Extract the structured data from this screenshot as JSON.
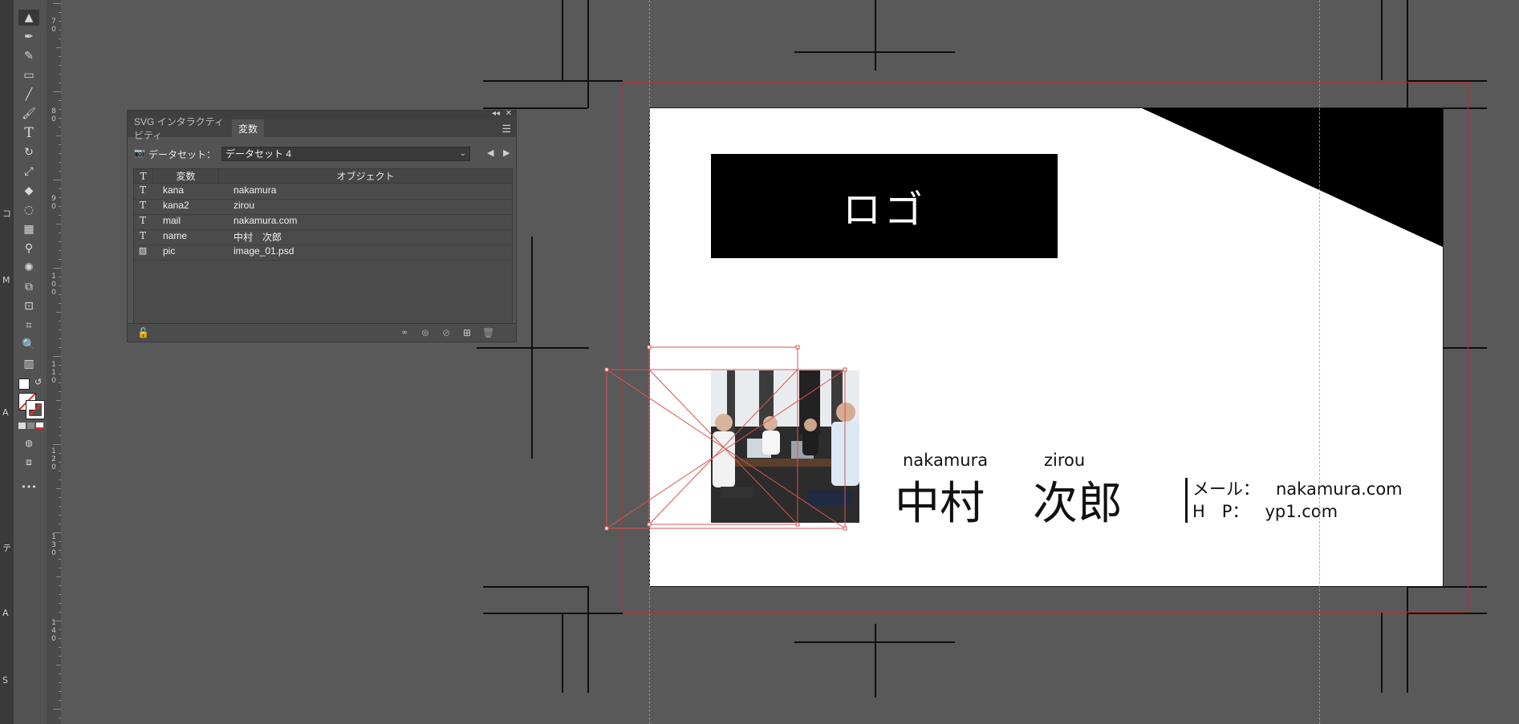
{
  "left_strip_letters": [
    "コ",
    "M",
    "A",
    "テ",
    "A",
    "S"
  ],
  "toolbar": {
    "tools": [
      {
        "name": "selection-tool",
        "glyph": "▲"
      },
      {
        "name": "pen-tool",
        "glyph": "✒"
      },
      {
        "name": "curvature-tool",
        "glyph": "✎"
      },
      {
        "name": "rectangle-tool",
        "glyph": "▭"
      },
      {
        "name": "line-tool",
        "glyph": "╱"
      },
      {
        "name": "paintbrush-tool",
        "glyph": "🖌"
      },
      {
        "name": "type-tool",
        "glyph": "T"
      },
      {
        "name": "rotate-tool",
        "glyph": "↻"
      },
      {
        "name": "scale-tool",
        "glyph": "⤢"
      },
      {
        "name": "eraser-tool",
        "glyph": "◆"
      },
      {
        "name": "lasso-tool",
        "glyph": "◌"
      },
      {
        "name": "gradient-tool",
        "glyph": "▦"
      },
      {
        "name": "eyedropper-tool",
        "glyph": "⚲"
      },
      {
        "name": "symbol-sprayer-tool",
        "glyph": "✺"
      },
      {
        "name": "shape-builder-tool",
        "glyph": "⧉"
      },
      {
        "name": "artboard-tool",
        "glyph": "⊡"
      },
      {
        "name": "slice-tool",
        "glyph": "⌗"
      },
      {
        "name": "zoom-tool",
        "glyph": "🔍"
      },
      {
        "name": "graph-tool",
        "glyph": "▥"
      }
    ],
    "more_glyph": "•••"
  },
  "ruler": {
    "numbers": [
      "7\n0",
      "8\n0",
      "9\n0",
      "1\n0\n0",
      "1\n1\n0",
      "1\n2\n0",
      "1\n3\n0",
      "1\n4\n0"
    ]
  },
  "panel": {
    "tabs": [
      "SVG インタラクティビティ",
      "変数"
    ],
    "active_tab": "変数",
    "dataset_label": "データセット：",
    "dataset_value": "データセット 4",
    "columns": {
      "type": "T",
      "variable": "変数",
      "object": "オブジェクト"
    },
    "rows": [
      {
        "type_icon": "T",
        "variable": "kana",
        "object": "nakamura"
      },
      {
        "type_icon": "T",
        "variable": "kana2",
        "object": "zirou"
      },
      {
        "type_icon": "T",
        "variable": "mail",
        "object": "nakamura.com"
      },
      {
        "type_icon": "T",
        "variable": "name",
        "object": "中村　次郎"
      },
      {
        "type_icon": "▨",
        "variable": "pic",
        "object": "image_01.psd"
      }
    ]
  },
  "card": {
    "logo": "ロゴ",
    "kana_family": "nakamura",
    "kana_given": "zirou",
    "name_family": "中村",
    "name_given": "次郎",
    "mail_label": "メール：",
    "mail_value": "nakamura.com",
    "hp_label": "H　P：",
    "hp_value": "yp1.com"
  },
  "colors": {
    "bleed_line": "#c8262b",
    "guide": "#6fb9b3",
    "selection": "#d9534f"
  }
}
